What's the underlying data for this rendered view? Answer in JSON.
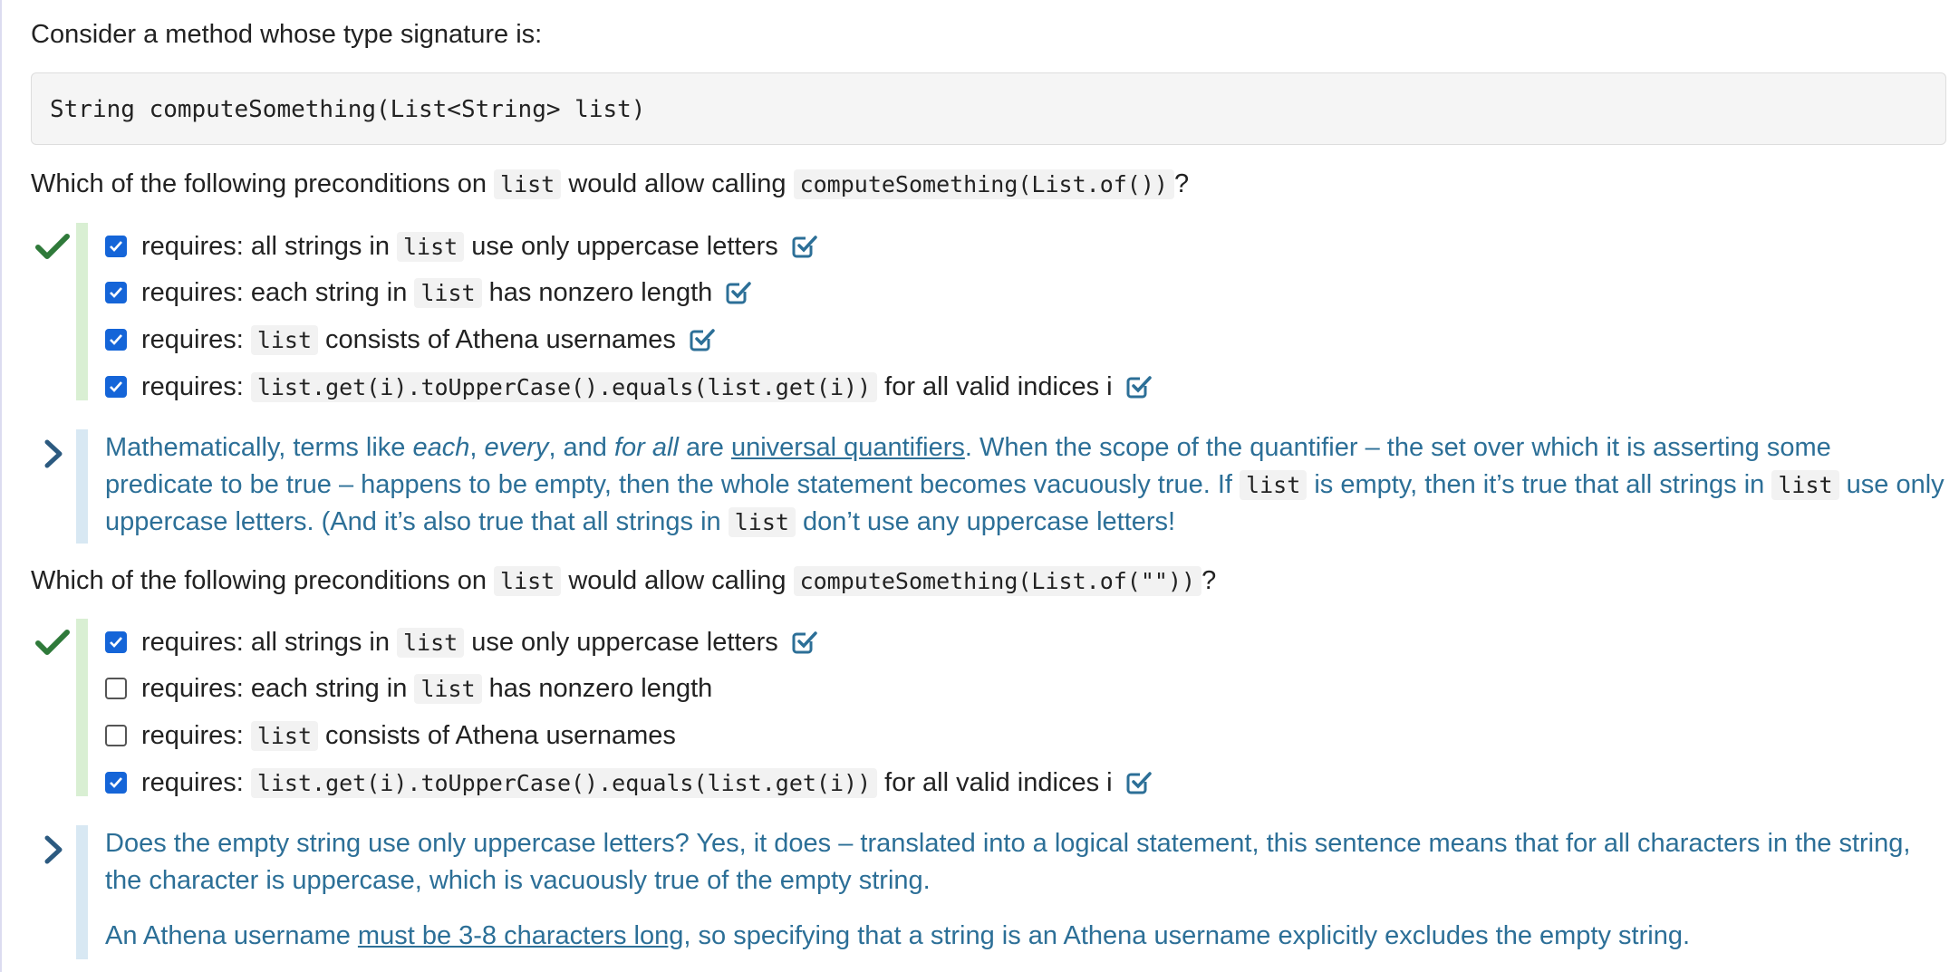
{
  "intro": "Consider a method whose type signature is:",
  "signature": "String computeSomething(List<String> list)",
  "q1": {
    "pre": "Which of the following preconditions on",
    "code1": "list",
    "mid": "would allow calling",
    "code2": "computeSomething(List.of())",
    "post": "?",
    "options": [
      {
        "a": "requires: all strings in",
        "code": "list",
        "b": "use only uppercase letters",
        "checked": true,
        "correct": true
      },
      {
        "a": "requires: each string in",
        "code": "list",
        "b": "has nonzero length",
        "checked": true,
        "correct": true
      },
      {
        "a": "requires:",
        "code": "list",
        "b": "consists of Athena usernames",
        "checked": true,
        "correct": true
      },
      {
        "a": "requires:",
        "code": "list.get(i).toUpperCase().equals(list.get(i))",
        "b": "for all valid indices i",
        "checked": true,
        "correct": true
      }
    ],
    "explanation": {
      "t1": "Mathematically, terms like ",
      "e1": "each",
      "t2": ", ",
      "e2": "every",
      "t3": ", and ",
      "e3": "for all",
      "t4": " are ",
      "link": "universal quantifiers",
      "t5": ". When the scope of the quantifier – the set over which it is asserting some predicate to be true – happens to be empty, then the whole statement becomes vacuously true. If ",
      "c1": "list",
      "t6": " is empty, then it’s true that all strings in ",
      "c2": "list",
      "t7": " use only uppercase letters. (And it’s also true that all strings in ",
      "c3": "list",
      "t8": " don’t use any uppercase letters!"
    }
  },
  "q2": {
    "pre": "Which of the following preconditions on",
    "code1": "list",
    "mid": "would allow calling",
    "code2": "computeSomething(List.of(\"\"))",
    "post": "?",
    "options": [
      {
        "a": "requires: all strings in",
        "code": "list",
        "b": "use only uppercase letters",
        "checked": true,
        "correct": true
      },
      {
        "a": "requires: each string in",
        "code": "list",
        "b": "has nonzero length",
        "checked": false,
        "correct": false
      },
      {
        "a": "requires:",
        "code": "list",
        "b": "consists of Athena usernames",
        "checked": false,
        "correct": false
      },
      {
        "a": "requires:",
        "code": "list.get(i).toUpperCase().equals(list.get(i))",
        "b": "for all valid indices i",
        "checked": true,
        "correct": true
      }
    ],
    "explanation": {
      "p1": "Does the empty string use only uppercase letters? Yes, it does – translated into a logical statement, this sentence means that for all characters in the string, the character is uppercase, which is vacuously true of the empty string.",
      "p2a": "An Athena username ",
      "link": "must be 3-8 characters long",
      "p2b": ", so specifying that a string is an Athena username explicitly excludes the empty string."
    }
  },
  "colors": {
    "correct_bar": "#d9efd3",
    "explain_bar": "#d8e8f3",
    "explain_text": "#2c6f97",
    "checkmark": "#2f7a3a",
    "checkbox": "#1565d8"
  },
  "icons": {
    "correct": "checkmark-icon",
    "checked_feedback": "check-square-icon",
    "expand": "chevron-right-icon"
  }
}
